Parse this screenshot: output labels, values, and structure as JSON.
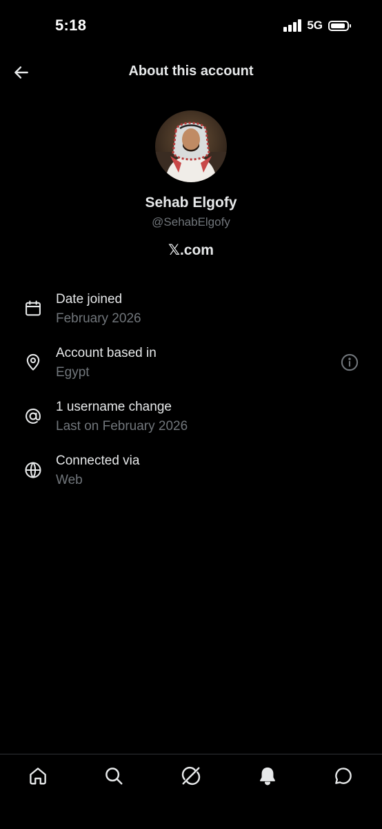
{
  "status_bar": {
    "time": "5:18",
    "network": "5G",
    "signal_bars": 4,
    "battery_level": 0.9
  },
  "header": {
    "back_icon": "arrow-left-icon",
    "title": "About this account"
  },
  "profile": {
    "avatar": "profile-photo",
    "display_name": "Sehab Elgofy",
    "handle": "@SehabElgofy",
    "site": "𝕏.com"
  },
  "info_rows": [
    {
      "icon": "calendar-icon",
      "title": "Date joined",
      "value": "February 2026"
    },
    {
      "icon": "location-pin-icon",
      "title": "Account based in",
      "value": "Egypt",
      "action_icon": "info-circle-icon"
    },
    {
      "icon": "at-sign-icon",
      "title": "1 username change",
      "value": "Last on February 2026"
    },
    {
      "icon": "globe-icon",
      "title": "Connected via",
      "value": "Web"
    }
  ],
  "bottom_nav": [
    {
      "icon": "home-icon"
    },
    {
      "icon": "search-icon"
    },
    {
      "icon": "grok-icon"
    },
    {
      "icon": "bell-icon",
      "active": true
    },
    {
      "icon": "messages-icon"
    }
  ],
  "colors": {
    "background": "#000000",
    "primary_text": "#e7e9ea",
    "secondary_text": "#71767b",
    "divider": "#2f3336"
  }
}
